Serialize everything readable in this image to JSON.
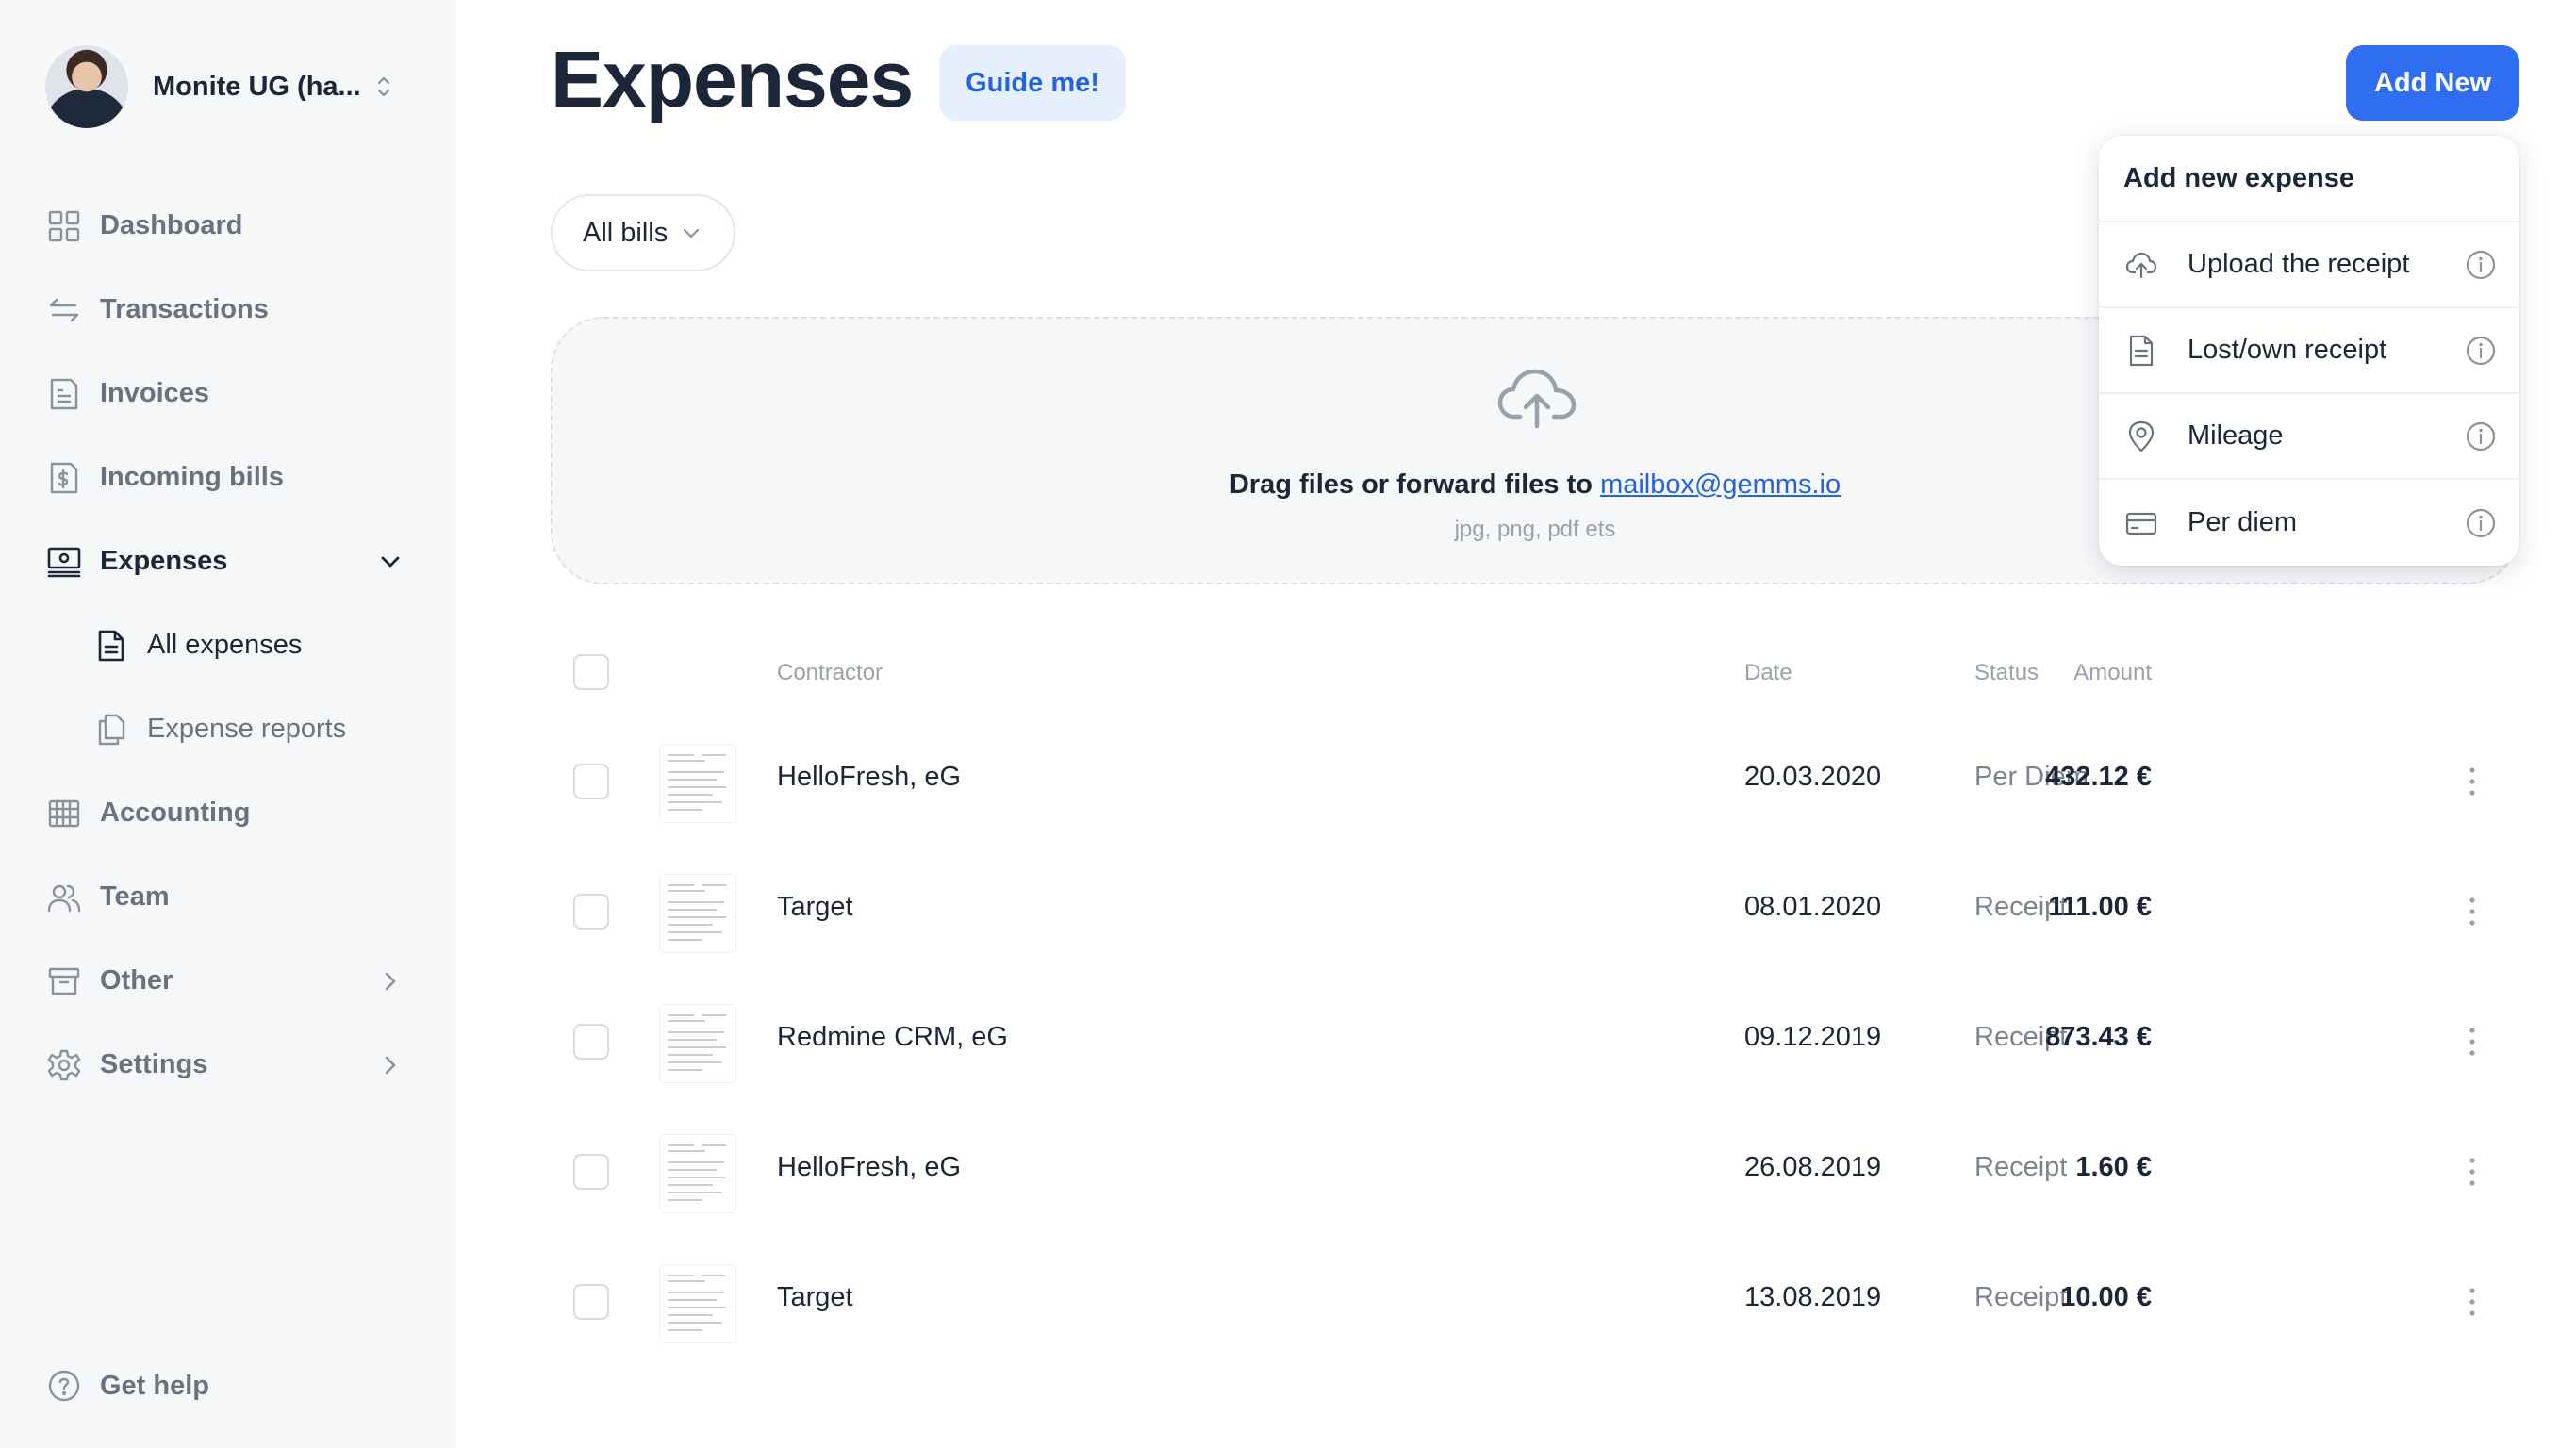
{
  "org": {
    "name": "Monite UG (ha..."
  },
  "nav": {
    "dashboard": "Dashboard",
    "transactions": "Transactions",
    "invoices": "Invoices",
    "incoming_bills": "Incoming bills",
    "expenses": "Expenses",
    "all_expenses": "All expenses",
    "expense_reports": "Expense reports",
    "accounting": "Accounting",
    "team": "Team",
    "other": "Other",
    "settings": "Settings",
    "get_help": "Get help"
  },
  "header": {
    "title": "Expenses",
    "guide_label": "Guide me!",
    "add_label": "Add New"
  },
  "filter": {
    "label": "All bills"
  },
  "dropzone": {
    "text": "Drag files or forward files to",
    "email": "mailbox@gemms.io",
    "hint": "jpg, png, pdf ets"
  },
  "table": {
    "headers": {
      "contractor": "Contractor",
      "date": "Date",
      "status": "Status",
      "amount": "Amount"
    },
    "rows": [
      {
        "contractor": "HelloFresh, eG",
        "date": "20.03.2020",
        "status": "Per Diem",
        "amount": "432.12 €"
      },
      {
        "contractor": "Target",
        "date": "08.01.2020",
        "status": "Receipt",
        "amount": "111.00 €"
      },
      {
        "contractor": "Redmine CRM, eG",
        "date": "09.12.2019",
        "status": "Receipt",
        "amount": "873.43 €"
      },
      {
        "contractor": "HelloFresh, eG",
        "date": "26.08.2019",
        "status": "Receipt",
        "amount": "1.60 €"
      },
      {
        "contractor": "Target",
        "date": "13.08.2019",
        "status": "Receipt",
        "amount": "10.00 €"
      }
    ]
  },
  "menu": {
    "title": "Add new expense",
    "items": [
      {
        "label": "Upload the receipt",
        "icon": "cloud-upload-icon"
      },
      {
        "label": "Lost/own receipt",
        "icon": "document-icon"
      },
      {
        "label": "Mileage",
        "icon": "location-pin-icon"
      },
      {
        "label": "Per diem",
        "icon": "credit-card-icon"
      }
    ]
  },
  "colors": {
    "accent": "#2f6ef0",
    "accent_soft": "#e6effc",
    "text": "#1b2638",
    "muted": "#7b8290"
  }
}
